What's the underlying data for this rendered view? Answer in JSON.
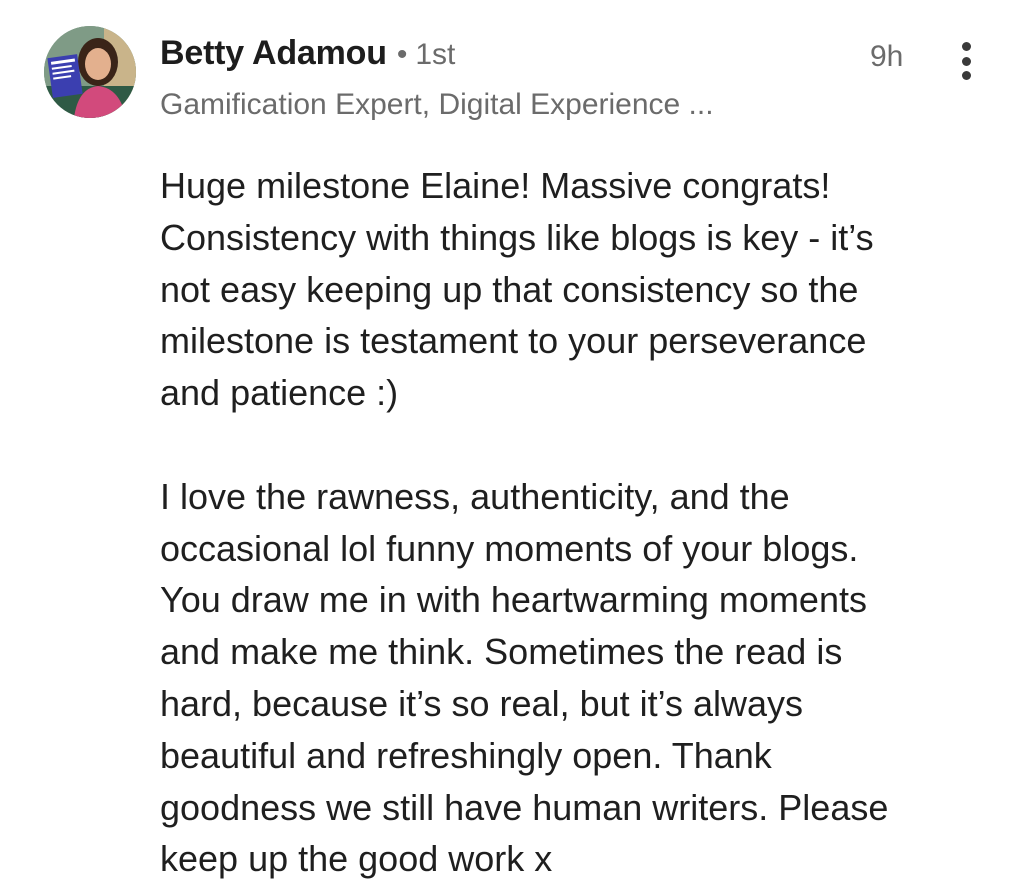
{
  "comment": {
    "author": {
      "name": "Betty Adamou",
      "degree": "1st",
      "separator": "•",
      "headline": "Gamification Expert, Digital Experience ...",
      "avatar_icon": "profile-photo-avatar",
      "avatar_book_text": "GAMES GAMIFICATION MARKET RESEARCH"
    },
    "timestamp": "9h",
    "menu_icon": "more-vertical-icon",
    "paragraphs": [
      {
        "lines": [
          "Huge milestone Elaine! Massive congrats!",
          "Consistency with things like blogs is key - it’s",
          "not easy keeping up that consistency so the",
          "milestone is testament to your perseverance",
          "and patience :)"
        ]
      },
      {
        "lines": [
          "I love the rawness, authenticity, and the",
          "occasional lol funny moments of your blogs.",
          "You draw me in with heartwarming moments",
          "and make me think. Sometimes the read is",
          "hard, because it’s so real, but it’s always",
          "beautiful and refreshingly open. Thank",
          "goodness we still have human writers. Please",
          "keep up the good work x"
        ]
      }
    ]
  },
  "colors": {
    "primary_text": "#1f1f1f",
    "secondary_text": "#6b6b6b",
    "background": "#ffffff"
  }
}
